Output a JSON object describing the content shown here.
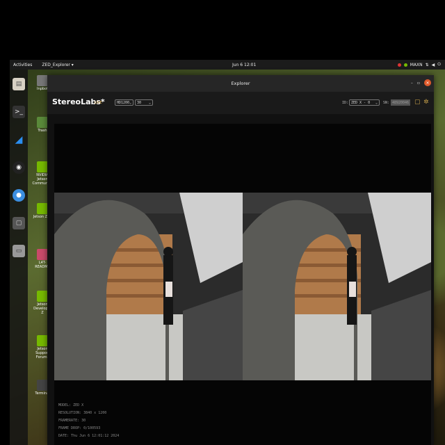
{
  "topbar": {
    "activities": "Activities",
    "app_menu": "ZED_Explorer ▾",
    "clock": "Jun 6  12:01",
    "power_mode": "MAXN"
  },
  "desktop_icons": [
    {
      "label": "Inpbot",
      "icon": "gear-icon"
    },
    {
      "label": "Trash",
      "icon": "trash-icon"
    },
    {
      "label": "NVIDIA Jetson Community",
      "icon": "nvidia-icon"
    },
    {
      "label": "Jetson Zoo",
      "icon": "nvidia-icon"
    },
    {
      "label": "L4T-README",
      "icon": "folder-icon"
    },
    {
      "label": "Jetson Developer Z",
      "icon": "nvidia-icon"
    },
    {
      "label": "Jetson Support Forums",
      "icon": "nvidia-icon"
    },
    {
      "label": "Terminal",
      "icon": "terminal-icon"
    }
  ],
  "dock": [
    "files-icon",
    "terminal-icon",
    "vscode-icon",
    "obs-icon",
    "chromium-icon",
    "app-icon",
    "drive-icon"
  ],
  "window": {
    "title": "Explorer",
    "brand": "StereoLabs*",
    "live_label": "LIVE",
    "resolution": "HD1200",
    "fps": "30",
    "id_label": "ID:",
    "camera": "ZED X - 0",
    "sn_label": "SN:",
    "sn_value": "48920046"
  },
  "info": {
    "model": "MODEL: ZED X",
    "resolution": "RESOLUTION: 3840 x 1200",
    "framerate": "FRAMERATE: 30",
    "frame_drop": "FRAME DROP: 0/100593",
    "date": "DATE: Thu Jun 6 12:01:12 2024"
  },
  "colors": {
    "accent": "#c9a24a",
    "close": "#e05a2b",
    "nvidia": "#76b900"
  }
}
